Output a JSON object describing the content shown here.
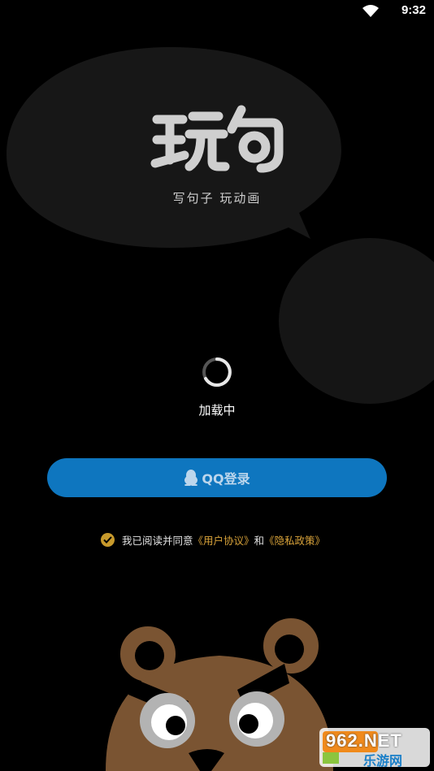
{
  "status_bar": {
    "time": "9:32",
    "wifi_icon": "wifi-icon"
  },
  "app": {
    "logo_text": "玩句",
    "slogan": "写句子 玩动画"
  },
  "loading": {
    "text": "加载中"
  },
  "login": {
    "qq_label": "QQ登录",
    "icon": "qq-penguin-icon"
  },
  "agreement": {
    "prefix": "我已阅读并同意",
    "user_agreement": "《用户协议》",
    "and": "和",
    "privacy_policy": "《隐私政策》",
    "checked": true
  },
  "watermark": {
    "top": "962.NET",
    "bottom": "乐游网"
  },
  "colors": {
    "background": "#000000",
    "button": "#0e76bf",
    "accent": "#c89a2c",
    "bubble": "#1a1a1a",
    "bear": "#7a5432"
  }
}
